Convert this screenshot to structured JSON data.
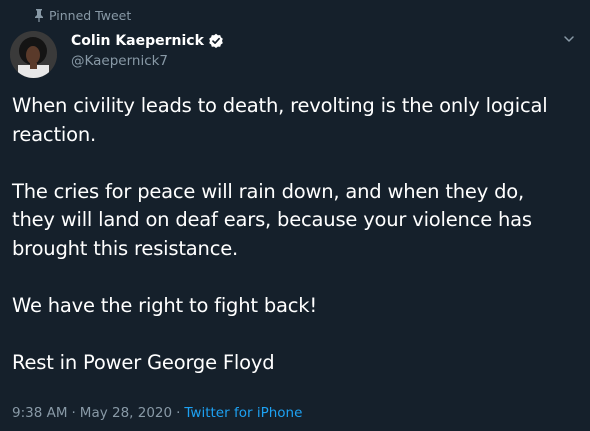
{
  "pinned": {
    "label": "Pinned Tweet"
  },
  "author": {
    "display_name": "Colin Kaepernick",
    "handle": "@Kaepernick7",
    "verified": true
  },
  "tweet": {
    "paragraphs": [
      "When civility leads to death, revolting is the only logical reaction.",
      "The cries for peace will rain down, and when they do, they will land on deaf ears, because your violence has brought this resistance.",
      "We have the right to fight back!",
      "Rest in Power George Floyd"
    ],
    "time": "9:38 AM",
    "date": "May 28, 2020",
    "separator": "·",
    "source": "Twitter for iPhone"
  },
  "icons": {
    "pin": "pin-icon",
    "verified": "verified-badge-icon",
    "menu": "chevron-down-icon"
  },
  "colors": {
    "background": "#15202b",
    "muted": "#8899a6",
    "accent": "#1da1f2",
    "text": "#ffffff"
  }
}
